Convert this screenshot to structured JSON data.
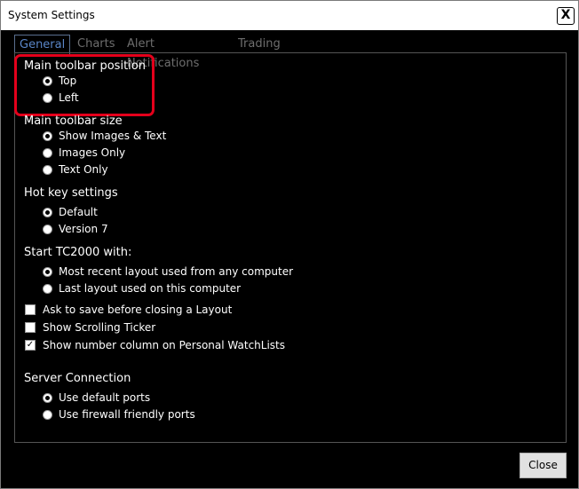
{
  "window": {
    "title": "System Settings",
    "close_glyph": "X"
  },
  "tabs": [
    {
      "label": "General",
      "active": true
    },
    {
      "label": "Charts",
      "active": false
    },
    {
      "label": "Alert Notifications",
      "active": false
    },
    {
      "label": "Trading",
      "active": false
    }
  ],
  "groups": {
    "toolbar_position": {
      "label": "Main toolbar position",
      "options": [
        {
          "label": "Top",
          "checked": true
        },
        {
          "label": "Left",
          "checked": false
        }
      ]
    },
    "toolbar_size": {
      "label": "Main toolbar size",
      "options": [
        {
          "label": "Show Images & Text",
          "checked": true
        },
        {
          "label": "Images Only",
          "checked": false
        },
        {
          "label": "Text Only",
          "checked": false
        }
      ]
    },
    "hot_key": {
      "label": "Hot key settings",
      "options": [
        {
          "label": "Default",
          "checked": true
        },
        {
          "label": "Version 7",
          "checked": false
        }
      ]
    },
    "start_with": {
      "label": "Start TC2000 with:",
      "options": [
        {
          "label": "Most recent layout used from any computer",
          "checked": true
        },
        {
          "label": "Last layout used on this computer",
          "checked": false
        }
      ]
    },
    "server": {
      "label": "Server Connection",
      "options": [
        {
          "label": "Use default ports",
          "checked": true
        },
        {
          "label": "Use firewall friendly ports",
          "checked": false
        }
      ]
    }
  },
  "checkboxes": [
    {
      "label": "Ask to save before closing a Layout",
      "checked": false
    },
    {
      "label": "Show Scrolling Ticker",
      "checked": false
    },
    {
      "label": "Show number column on Personal WatchLists",
      "checked": true
    }
  ],
  "check_glyph": "✓",
  "footer": {
    "close_label": "Close"
  },
  "colors": {
    "background": "#000000",
    "active_tab": "#5a86c8",
    "inactive_tab": "#6e6e6e",
    "highlight": "#e4001b"
  }
}
